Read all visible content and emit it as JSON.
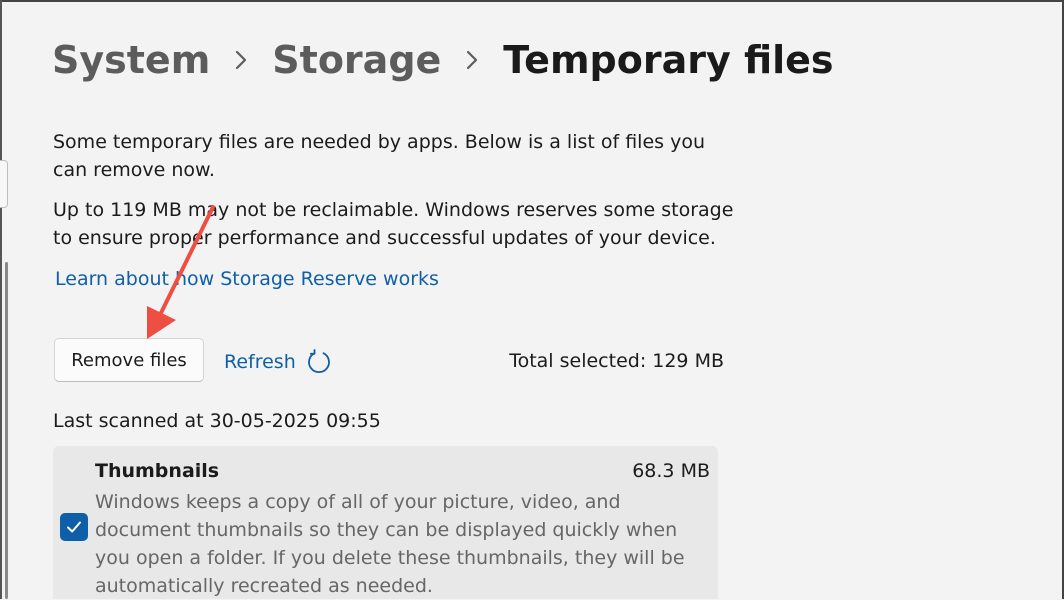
{
  "breadcrumb": {
    "items": [
      "System",
      "Storage",
      "Temporary files"
    ]
  },
  "content": {
    "intro_text": "Some temporary files are needed by apps. Below is a list of files you can remove now.",
    "reserve_text": "Up to 119 MB may not be reclaimable. Windows reserves some storage to ensure proper performance and successful updates of your device.",
    "learn_link": "Learn about how Storage Reserve works"
  },
  "actions": {
    "remove_label": "Remove files",
    "refresh_label": "Refresh",
    "total_selected": "Total selected: 129 MB"
  },
  "scan": {
    "last_scanned": "Last scanned at 30-05-2025 09:55"
  },
  "items": [
    {
      "title": "Thumbnails",
      "size": "68.3 MB",
      "description": "Windows keeps a copy of all of your picture, video, and document thumbnails so they can be displayed quickly when you open a folder. If you delete these thumbnails, they will be automatically recreated as needed.",
      "checked": true
    }
  ],
  "colors": {
    "accent": "#0f5fa8",
    "annotation_arrow": "#ef4e43"
  },
  "icons": {
    "separator": "chevron-right-icon",
    "refresh": "refresh-icon",
    "checkbox": "checkmark-icon"
  }
}
